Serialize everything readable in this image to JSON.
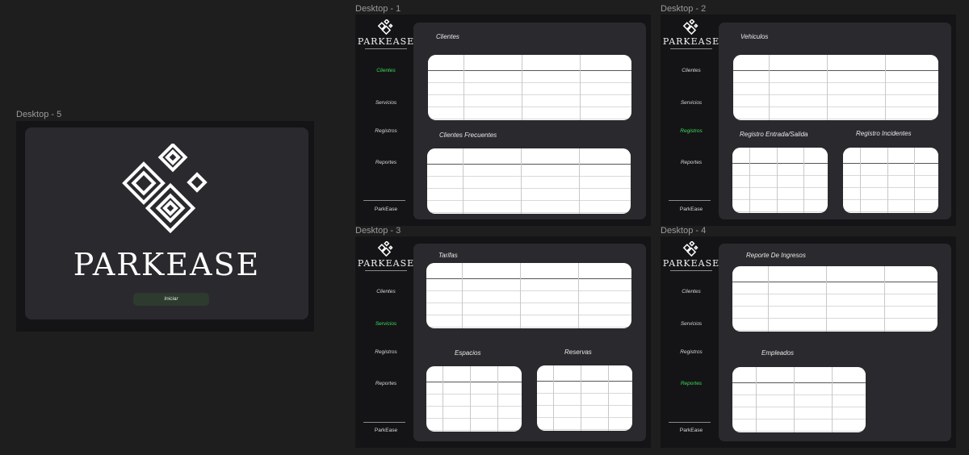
{
  "frames": {
    "d5": "Desktop - 5",
    "d1": "Desktop - 1",
    "d2": "Desktop - 2",
    "d3": "Desktop - 3",
    "d4": "Desktop - 4"
  },
  "brand": {
    "name": "PARKEASE",
    "logo_icon": "diamond-logo-icon"
  },
  "nav": {
    "clientes": "Clientes",
    "servicios": "Servicios",
    "registros": "Registros",
    "reportes": "Reportes"
  },
  "footer": "ParkEase",
  "splash": {
    "start_label": "Iniciar"
  },
  "d1": {
    "t1": "Clientes",
    "t2": "Clientes Frecuentes",
    "active": "clientes"
  },
  "d2": {
    "t1": "Vehiculos",
    "t2": "Registro Entrada/Salida",
    "t3": "Registro Incidentes",
    "active": "registros"
  },
  "d3": {
    "t1": "Tarifas",
    "t2": "Espacios",
    "t3": "Reservas",
    "active": "servicios"
  },
  "d4": {
    "t1": "Reporte De Ingresos",
    "t2": "Empleados",
    "active": "reportes"
  },
  "colors": {
    "active_nav": "#3ddc5a",
    "panel": "#2a2a2e",
    "frame": "#141416",
    "button": "#2d3b2e"
  }
}
